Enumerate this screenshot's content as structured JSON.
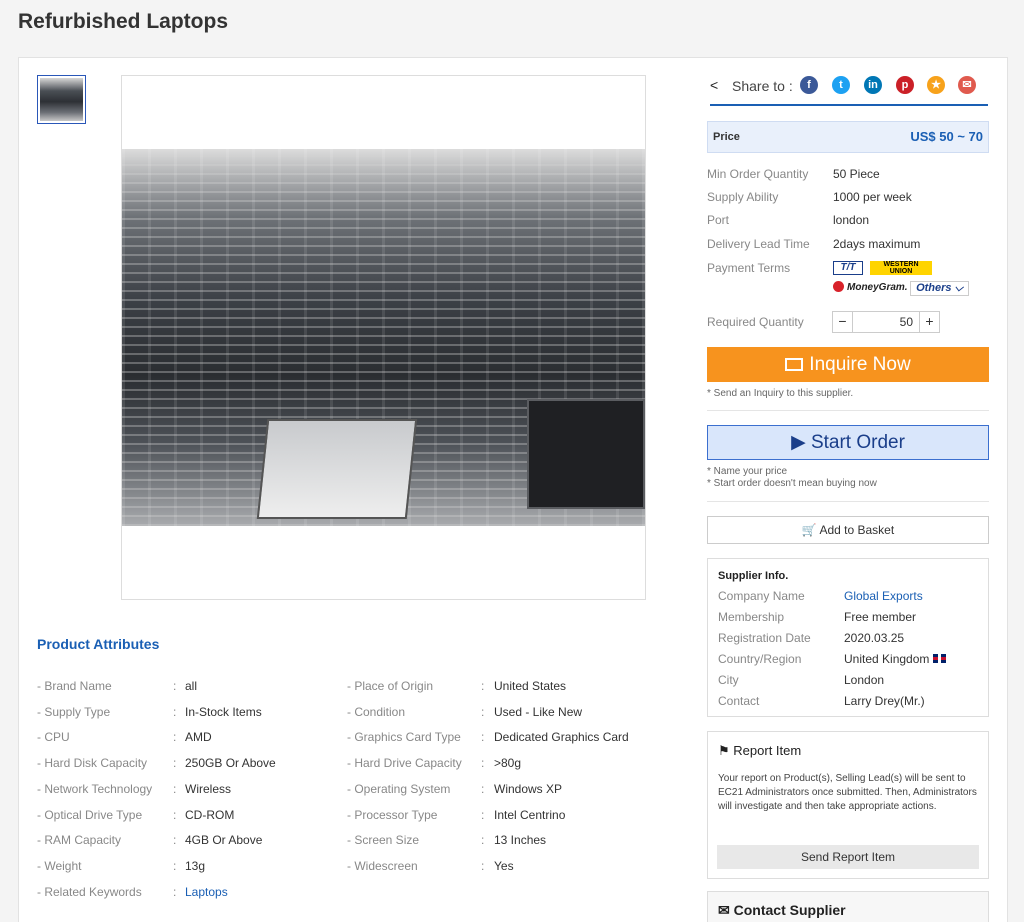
{
  "page": {
    "title": "Refurbished Laptops"
  },
  "attributes": {
    "title": "Product Attributes",
    "left": [
      {
        "label": "- Brand Name",
        "value": "all"
      },
      {
        "label": "- Supply Type",
        "value": "In-Stock Items"
      },
      {
        "label": "- CPU",
        "value": "AMD"
      },
      {
        "label": "- Hard Disk Capacity",
        "value": "250GB Or Above"
      },
      {
        "label": "- Network Technology",
        "value": "Wireless"
      },
      {
        "label": "- Optical Drive Type",
        "value": "CD-ROM"
      },
      {
        "label": "- RAM Capacity",
        "value": "4GB Or Above"
      },
      {
        "label": "- Weight",
        "value": "13g"
      },
      {
        "label": "- Related Keywords",
        "value": "Laptops"
      }
    ],
    "right": [
      {
        "label": "- Place of Origin",
        "value": "United States"
      },
      {
        "label": "- Condition",
        "value": "Used - Like New"
      },
      {
        "label": "- Graphics Card Type",
        "value": "Dedicated Graphics Card"
      },
      {
        "label": "- Hard Drive Capacity",
        "value": ">80g"
      },
      {
        "label": "- Operating System",
        "value": "Windows XP"
      },
      {
        "label": "- Processor Type",
        "value": "Intel Centrino"
      },
      {
        "label": "- Screen Size",
        "value": "13 Inches"
      },
      {
        "label": "- Widescreen",
        "value": "Yes"
      }
    ],
    "separator": ":"
  },
  "share": {
    "label": "Share to :",
    "networks": [
      {
        "name": "facebook",
        "glyph": "f",
        "color": "#3b5998"
      },
      {
        "name": "twitter",
        "glyph": "t",
        "color": "#1da1f2"
      },
      {
        "name": "linkedin",
        "glyph": "in",
        "color": "#0077b5"
      },
      {
        "name": "pinterest",
        "glyph": "p",
        "color": "#cb2027"
      },
      {
        "name": "favorite",
        "glyph": "★",
        "color": "#f7a21b"
      },
      {
        "name": "email",
        "glyph": "✉",
        "color": "#e05a4e"
      }
    ]
  },
  "price": {
    "label": "Price",
    "value": "US$  50 ~ 70"
  },
  "specs": [
    {
      "k": "Min Order Quantity",
      "v": "50 Piece"
    },
    {
      "k": "Supply Ability",
      "v": "1000 per week"
    },
    {
      "k": "Port",
      "v": "london"
    },
    {
      "k": "Delivery Lead Time",
      "v": "2days maximum"
    },
    {
      "k": "Payment Terms",
      "v": ""
    }
  ],
  "payment": {
    "tt": "T/T",
    "wu_line1": "WESTERN",
    "wu_line2": "UNION",
    "mg": "MoneyGram.",
    "others": "Others ⌵"
  },
  "quantity": {
    "label": "Required Quantity",
    "minus": "−",
    "value": "50",
    "plus": "+"
  },
  "inquire": {
    "label": "Inquire Now",
    "note": "* Send an Inquiry to this supplier."
  },
  "start_order": {
    "label": "▶ Start Order",
    "note1": "* Name your price",
    "note2": "* Start order doesn't mean buying now"
  },
  "basket": {
    "label": "🛒 Add to Basket"
  },
  "supplier": {
    "title": "Supplier Info.",
    "rows": [
      {
        "k": "Company Name",
        "v": "Global Exports"
      },
      {
        "k": "Membership",
        "v": "Free member"
      },
      {
        "k": "Registration Date",
        "v": "2020.03.25"
      },
      {
        "k": "Country/Region",
        "v": "United Kingdom"
      },
      {
        "k": "City",
        "v": "London"
      },
      {
        "k": "Contact",
        "v": "Larry Drey(Mr.)"
      }
    ]
  },
  "report": {
    "title": "Report Item",
    "text": "Your report on Product(s), Selling Lead(s) will be sent to EC21 Administrators once submitted. Then, Administrators will investigate and then take appropriate actions.",
    "button": "Send Report Item"
  },
  "contact": {
    "title": "Contact Supplier"
  },
  "colors": {
    "accent": "#1a5fb4",
    "inquire": "#f7931e",
    "start_order_bg": "#d9e6fb"
  }
}
